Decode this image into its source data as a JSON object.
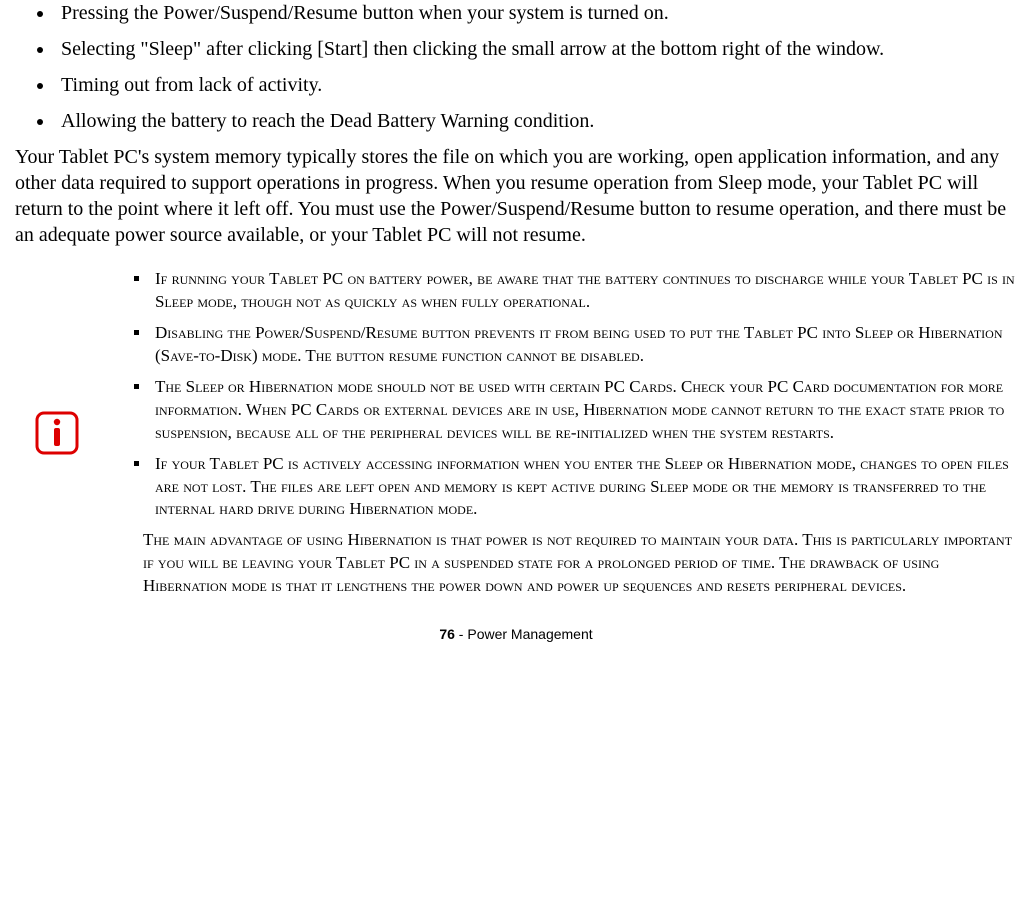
{
  "topBullets": [
    "Pressing the Power/Suspend/Resume button when your system is turned on.",
    "Selecting \"Sleep\" after clicking [Start] then clicking the small arrow at the bottom right of the window.",
    "Timing out from lack of activity.",
    "Allowing the battery to reach the Dead Battery Warning condition."
  ],
  "bodyPara": "Your Tablet PC's system memory typically stores the file on which you are working, open application information, and any other data required to support operations in progress. When you resume operation from Sleep mode, your Tablet PC will return to the point where it left off. You must use the Power/Suspend/Resume button to resume operation, and there must be an adequate power source available, or your Tablet PC will not resume.",
  "infoBullets": [
    "If running your Tablet PC on battery power, be aware that the battery continues to discharge while your Tablet PC is in Sleep mode, though not as quickly as when fully operational.",
    "Disabling the Power/Suspend/Resume button prevents it from being used to put the Tablet PC into Sleep or Hibernation (Save-to-Disk) mode. The button resume function cannot be disabled.",
    "The Sleep or Hibernation mode should not be used with certain PC Cards. Check your PC Card documentation for more information. When PC Cards or external devices are in use, Hibernation mode cannot return to the exact state prior to suspension, because all of the peripheral devices will be re-initialized when the system restarts.",
    "If your Tablet PC is actively accessing information when you enter the Sleep or Hibernation mode, changes to open files are not lost. The files are left open and memory is kept active during Sleep mode or the memory is transferred to the internal hard drive during Hibernation mode."
  ],
  "infoNote": "The main advantage of using Hibernation is that power is not required to maintain your data. This is particularly important if you will be leaving your Tablet PC in a suspended state for a prolonged period of time. The drawback of using Hibernation mode is that it lengthens the power down and power up sequences and resets peripheral devices.",
  "footer": {
    "pageNum": "76",
    "sep": " - ",
    "section": "Power Management"
  }
}
